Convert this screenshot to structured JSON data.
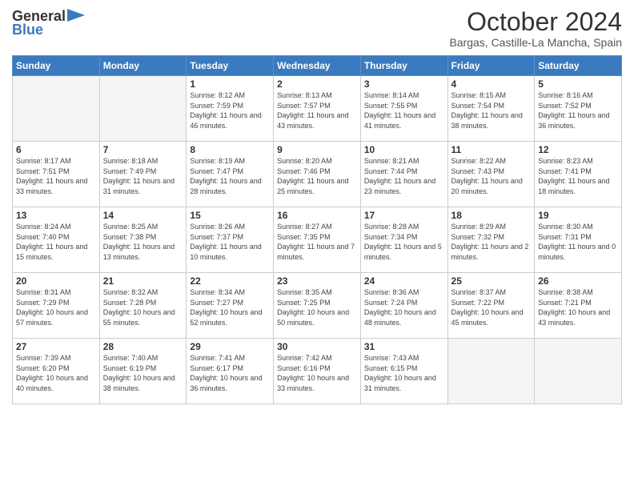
{
  "header": {
    "logo_line1": "General",
    "logo_line2": "Blue",
    "month": "October 2024",
    "location": "Bargas, Castille-La Mancha, Spain"
  },
  "days_of_week": [
    "Sunday",
    "Monday",
    "Tuesday",
    "Wednesday",
    "Thursday",
    "Friday",
    "Saturday"
  ],
  "weeks": [
    [
      {
        "day": "",
        "info": ""
      },
      {
        "day": "",
        "info": ""
      },
      {
        "day": "1",
        "info": "Sunrise: 8:12 AM\nSunset: 7:59 PM\nDaylight: 11 hours and 46 minutes."
      },
      {
        "day": "2",
        "info": "Sunrise: 8:13 AM\nSunset: 7:57 PM\nDaylight: 11 hours and 43 minutes."
      },
      {
        "day": "3",
        "info": "Sunrise: 8:14 AM\nSunset: 7:55 PM\nDaylight: 11 hours and 41 minutes."
      },
      {
        "day": "4",
        "info": "Sunrise: 8:15 AM\nSunset: 7:54 PM\nDaylight: 11 hours and 38 minutes."
      },
      {
        "day": "5",
        "info": "Sunrise: 8:16 AM\nSunset: 7:52 PM\nDaylight: 11 hours and 36 minutes."
      }
    ],
    [
      {
        "day": "6",
        "info": "Sunrise: 8:17 AM\nSunset: 7:51 PM\nDaylight: 11 hours and 33 minutes."
      },
      {
        "day": "7",
        "info": "Sunrise: 8:18 AM\nSunset: 7:49 PM\nDaylight: 11 hours and 31 minutes."
      },
      {
        "day": "8",
        "info": "Sunrise: 8:19 AM\nSunset: 7:47 PM\nDaylight: 11 hours and 28 minutes."
      },
      {
        "day": "9",
        "info": "Sunrise: 8:20 AM\nSunset: 7:46 PM\nDaylight: 11 hours and 25 minutes."
      },
      {
        "day": "10",
        "info": "Sunrise: 8:21 AM\nSunset: 7:44 PM\nDaylight: 11 hours and 23 minutes."
      },
      {
        "day": "11",
        "info": "Sunrise: 8:22 AM\nSunset: 7:43 PM\nDaylight: 11 hours and 20 minutes."
      },
      {
        "day": "12",
        "info": "Sunrise: 8:23 AM\nSunset: 7:41 PM\nDaylight: 11 hours and 18 minutes."
      }
    ],
    [
      {
        "day": "13",
        "info": "Sunrise: 8:24 AM\nSunset: 7:40 PM\nDaylight: 11 hours and 15 minutes."
      },
      {
        "day": "14",
        "info": "Sunrise: 8:25 AM\nSunset: 7:38 PM\nDaylight: 11 hours and 13 minutes."
      },
      {
        "day": "15",
        "info": "Sunrise: 8:26 AM\nSunset: 7:37 PM\nDaylight: 11 hours and 10 minutes."
      },
      {
        "day": "16",
        "info": "Sunrise: 8:27 AM\nSunset: 7:35 PM\nDaylight: 11 hours and 7 minutes."
      },
      {
        "day": "17",
        "info": "Sunrise: 8:28 AM\nSunset: 7:34 PM\nDaylight: 11 hours and 5 minutes."
      },
      {
        "day": "18",
        "info": "Sunrise: 8:29 AM\nSunset: 7:32 PM\nDaylight: 11 hours and 2 minutes."
      },
      {
        "day": "19",
        "info": "Sunrise: 8:30 AM\nSunset: 7:31 PM\nDaylight: 11 hours and 0 minutes."
      }
    ],
    [
      {
        "day": "20",
        "info": "Sunrise: 8:31 AM\nSunset: 7:29 PM\nDaylight: 10 hours and 57 minutes."
      },
      {
        "day": "21",
        "info": "Sunrise: 8:32 AM\nSunset: 7:28 PM\nDaylight: 10 hours and 55 minutes."
      },
      {
        "day": "22",
        "info": "Sunrise: 8:34 AM\nSunset: 7:27 PM\nDaylight: 10 hours and 52 minutes."
      },
      {
        "day": "23",
        "info": "Sunrise: 8:35 AM\nSunset: 7:25 PM\nDaylight: 10 hours and 50 minutes."
      },
      {
        "day": "24",
        "info": "Sunrise: 8:36 AM\nSunset: 7:24 PM\nDaylight: 10 hours and 48 minutes."
      },
      {
        "day": "25",
        "info": "Sunrise: 8:37 AM\nSunset: 7:22 PM\nDaylight: 10 hours and 45 minutes."
      },
      {
        "day": "26",
        "info": "Sunrise: 8:38 AM\nSunset: 7:21 PM\nDaylight: 10 hours and 43 minutes."
      }
    ],
    [
      {
        "day": "27",
        "info": "Sunrise: 7:39 AM\nSunset: 6:20 PM\nDaylight: 10 hours and 40 minutes."
      },
      {
        "day": "28",
        "info": "Sunrise: 7:40 AM\nSunset: 6:19 PM\nDaylight: 10 hours and 38 minutes."
      },
      {
        "day": "29",
        "info": "Sunrise: 7:41 AM\nSunset: 6:17 PM\nDaylight: 10 hours and 36 minutes."
      },
      {
        "day": "30",
        "info": "Sunrise: 7:42 AM\nSunset: 6:16 PM\nDaylight: 10 hours and 33 minutes."
      },
      {
        "day": "31",
        "info": "Sunrise: 7:43 AM\nSunset: 6:15 PM\nDaylight: 10 hours and 31 minutes."
      },
      {
        "day": "",
        "info": ""
      },
      {
        "day": "",
        "info": ""
      }
    ]
  ]
}
